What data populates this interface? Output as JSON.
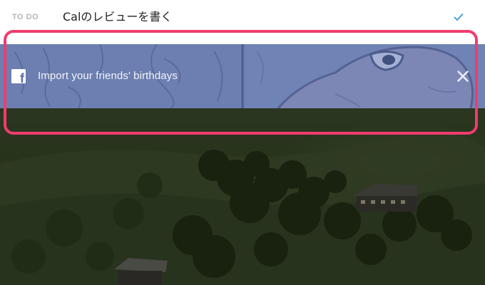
{
  "todo": {
    "label": "TO DO",
    "input_value": "Calのレビューを書く",
    "check_icon": "checkmark-icon"
  },
  "banner": {
    "text": "Import your friends' birthdays",
    "icon": "facebook-icon",
    "icon_glyph": "f",
    "close_icon": "close-icon"
  },
  "colors": {
    "check": "#3a9ad9",
    "highlight": "#f03c6e",
    "banner_tint": "#6a7fae"
  }
}
